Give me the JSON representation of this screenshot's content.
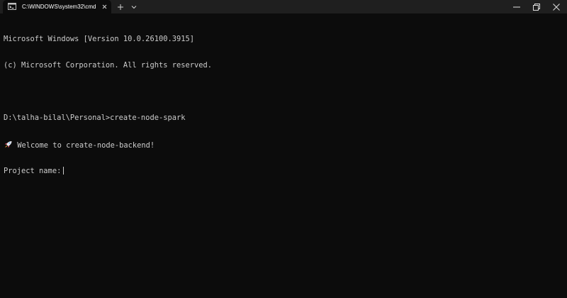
{
  "tab": {
    "title": "C:\\WINDOWS\\system32\\cmd.",
    "icon": "command-prompt-icon"
  },
  "titlebar": {
    "new_tab_icon": "plus-icon",
    "dropdown_icon": "chevron-down-icon",
    "minimize_icon": "minimize-icon",
    "maximize_icon": "restore-icon",
    "close_icon": "close-icon"
  },
  "console": {
    "lines": [
      "Microsoft Windows [Version 10.0.26100.3915]",
      "(c) Microsoft Corporation. All rights reserved.",
      "",
      "D:\\talha-bilal\\Personal>create-node-spark",
      "Welcome to create-node-backend!",
      "Project name:"
    ],
    "welcome_icon": "rocket-icon"
  },
  "colors": {
    "background": "#0c0c0c",
    "titlebar": "#1f1f1f",
    "text": "#cccccc"
  }
}
